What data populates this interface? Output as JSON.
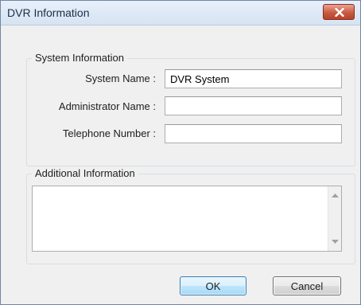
{
  "window": {
    "title": "DVR Information"
  },
  "system_info": {
    "legend": "System Information",
    "fields": [
      {
        "label": "System Name :",
        "value": "DVR System"
      },
      {
        "label": "Administrator Name :",
        "value": ""
      },
      {
        "label": "Telephone Number :",
        "value": ""
      }
    ]
  },
  "additional_info": {
    "legend": "Additional Information",
    "value": ""
  },
  "buttons": {
    "ok": "OK",
    "cancel": "Cancel"
  },
  "icons": {
    "close": "close-icon",
    "scroll_up": "scroll-up-arrow-icon",
    "scroll_down": "scroll-down-arrow-icon"
  },
  "colors": {
    "close_button": "#c85b42",
    "ok_button_border": "#3c7fb1",
    "dialog_background": "#f0f0f0"
  }
}
